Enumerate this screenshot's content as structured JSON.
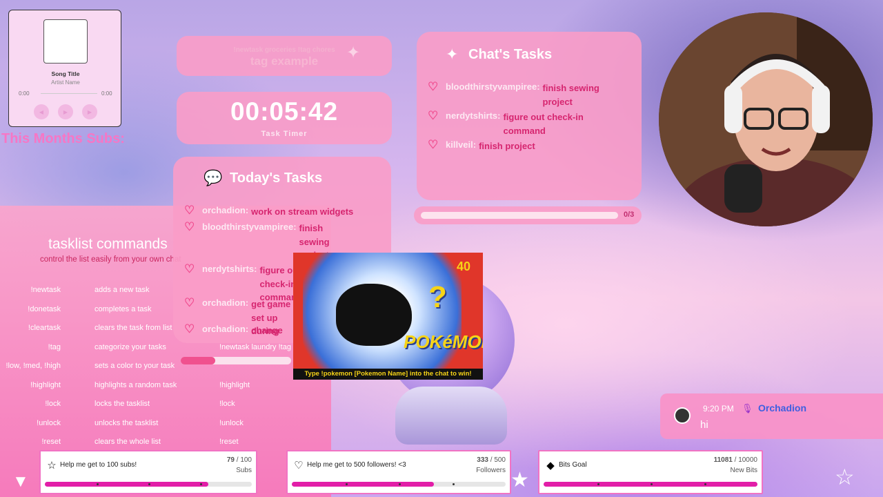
{
  "music_player": {
    "song_title": "Song Title",
    "artist": "Artist Name",
    "time_current": "0:00",
    "time_total": "0:00",
    "prev_icon": "prev-icon",
    "play_icon": "play-icon",
    "next_icon": "next-icon"
  },
  "subs_title": "This Months Subs:",
  "tag_panel": {
    "hint": "!newtask groceries !tag chores",
    "example": "tag example"
  },
  "timer": {
    "value": "00:05:42",
    "label": "Task Timer"
  },
  "today_tasks": {
    "title": "Today's Tasks",
    "items": [
      {
        "user": "orchadion:",
        "task": "work on stream widgets"
      },
      {
        "user": "bloodthirstyvampiree:",
        "task": "finish sewing project"
      },
      {
        "user": "nerdytshirts:",
        "task": "figure out check-in command"
      },
      {
        "user": "orchadion:",
        "task": "get game set up during"
      },
      {
        "user": "orchadion:",
        "task": "change"
      }
    ]
  },
  "chat_tasks": {
    "title": "Chat's Tasks",
    "items": [
      {
        "user": "bloodthirstyvampiree:",
        "task": "finish sewing project"
      },
      {
        "user": "nerdytshirts:",
        "task": "figure out check-in command"
      },
      {
        "user": "killveil:",
        "task": "finish project"
      }
    ],
    "progress_count": "0/3",
    "progress": 0
  },
  "commands": {
    "title": "tasklist commands",
    "subtitle": "control the list easily from your own chat",
    "rows": [
      {
        "cmd": "!newtask",
        "desc": "adds a new task",
        "example": ""
      },
      {
        "cmd": "!donetask",
        "desc": "completes a task",
        "example": ""
      },
      {
        "cmd": "!cleartask",
        "desc": "clears the task from list",
        "example": ""
      },
      {
        "cmd": "!tag",
        "desc": "categorize your tasks",
        "example": "!newtask laundry !tag"
      },
      {
        "cmd": "!low, !med, !high",
        "desc": "sets a color to your task",
        "example": ""
      },
      {
        "cmd": "!highlight",
        "desc": "highlights a random task",
        "example": "!highlight"
      },
      {
        "cmd": "!lock",
        "desc": "locks the tasklist",
        "example": "!lock"
      },
      {
        "cmd": "!unlock",
        "desc": "unlocks the tasklist",
        "example": "!unlock"
      },
      {
        "cmd": "!reset",
        "desc": "clears the whole list",
        "example": "!reset"
      }
    ]
  },
  "pokemon": {
    "number": "40",
    "question": "?",
    "logo": "POKéMON",
    "caption": "Type !pokemon [Pokemon Name] into the chat to win!"
  },
  "chat_message": {
    "time": "9:20 PM",
    "user": "Orchadion",
    "text": "hi",
    "user_color": "#3e5fe0"
  },
  "goals": [
    {
      "label": "Help me get to 100 subs!",
      "current": "79",
      "target": "100",
      "unit": "Subs",
      "progress": 0.79,
      "icon": "star-icon"
    },
    {
      "label": "Help me get to 500 followers! <3",
      "current": "333",
      "target": "500",
      "unit": "Followers",
      "progress": 0.666,
      "icon": "heart-icon"
    },
    {
      "label": "Bits Goal",
      "current": "11081",
      "target": "10000",
      "unit": "New Bits",
      "progress": 1.0,
      "icon": "bits-icon"
    }
  ],
  "colors": {
    "accent_pink": "#f99cc8",
    "task_text": "#d6256f",
    "goal_fill": "#e21ea8"
  }
}
